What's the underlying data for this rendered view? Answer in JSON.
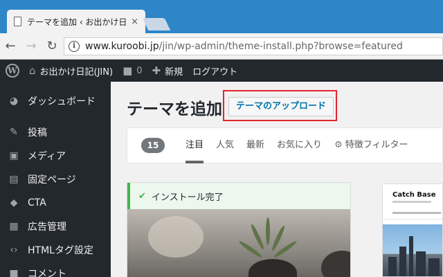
{
  "browser": {
    "tab_title": "テーマを追加 ‹ お出かけ日記",
    "tab_close": "×",
    "url_host": "www.kuroobi.jp",
    "url_path": "/jin/wp-admin/theme-install.php?browse=featured",
    "back_glyph": "←",
    "forward_glyph": "→",
    "reload_glyph": "↻"
  },
  "adminbar": {
    "site_name": "お出かけ日記(JIN)",
    "comments_count": "0",
    "new_label": "新規",
    "logout_label": "ログアウト"
  },
  "sidebar": {
    "items": [
      {
        "label": "ダッシュボード",
        "icon": "dashboard-icon",
        "glyph": "◕"
      },
      {
        "label": "投稿",
        "icon": "pin-icon",
        "glyph": "✎"
      },
      {
        "label": "メディア",
        "icon": "media-icon",
        "glyph": "▣"
      },
      {
        "label": "固定ページ",
        "icon": "page-icon",
        "glyph": "▤"
      },
      {
        "label": "CTA",
        "icon": "tag-icon",
        "glyph": "◆"
      },
      {
        "label": "広告管理",
        "icon": "ad-icon",
        "glyph": "▦"
      },
      {
        "label": "HTMLタグ設定",
        "icon": "code-icon",
        "glyph": "‹›"
      },
      {
        "label": "コメント",
        "icon": "comment-icon",
        "glyph": "■"
      }
    ]
  },
  "main": {
    "title": "テーマを追加",
    "upload_button": "テーマのアップロード",
    "theme_count": "15",
    "tabs": [
      "注目",
      "人気",
      "最新",
      "お気に入り"
    ],
    "feature_filter": "特徴フィルター",
    "install_notice": "インストール完了",
    "theme2_name": "Catch Base"
  },
  "colors": {
    "highlight_box": "#e3242b",
    "admin_dark": "#23282d",
    "wp_blue": "#0073aa",
    "success_green": "#46b450"
  }
}
